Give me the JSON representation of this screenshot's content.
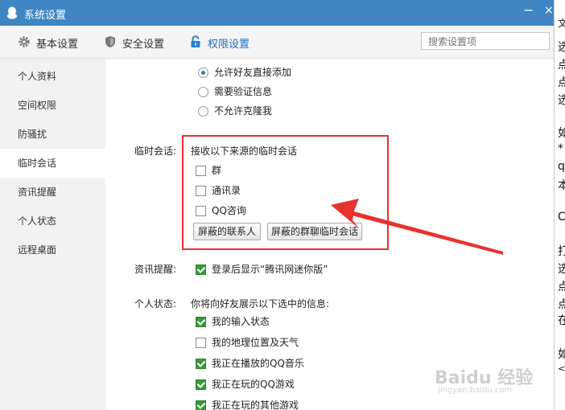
{
  "window": {
    "title": "系统设置",
    "minimize": "−",
    "close": "×"
  },
  "toolbar": {
    "tabs": [
      {
        "label": "基本设置",
        "icon": "gear-icon"
      },
      {
        "label": "安全设置",
        "icon": "shield-icon"
      },
      {
        "label": "权限设置",
        "icon": "lock-icon"
      }
    ],
    "active_tab": "权限设置",
    "search_placeholder": "搜索设置项"
  },
  "sidebar": {
    "items": [
      {
        "label": "个人资料"
      },
      {
        "label": "空间权限"
      },
      {
        "label": "防骚扰"
      },
      {
        "label": "临时会话"
      },
      {
        "label": "资讯提醒"
      },
      {
        "label": "个人状态"
      },
      {
        "label": "远程桌面"
      }
    ],
    "selected": "临时会话"
  },
  "friend_add": {
    "options": [
      {
        "label": "允许好友直接添加",
        "selected": true
      },
      {
        "label": "需要验证信息",
        "selected": false
      },
      {
        "label": "不允许克隆我",
        "selected": false
      }
    ]
  },
  "temp_session": {
    "label": "临时会话:",
    "heading": "接收以下来源的临时会话",
    "options": [
      {
        "label": "群",
        "checked": false
      },
      {
        "label": "通讯录",
        "checked": false
      },
      {
        "label": "QQ咨询",
        "checked": false
      }
    ],
    "buttons": {
      "blocked_contacts": "屏蔽的联系人",
      "blocked_group_chats": "屏蔽的群聊临时会话"
    }
  },
  "news_reminder": {
    "label": "资讯提醒:",
    "option": {
      "label": "登录后显示“腾讯网迷你版”",
      "checked": true
    }
  },
  "personal_status": {
    "label": "个人状态:",
    "heading": "你将向好友展示以下选中的信息:",
    "options": [
      {
        "label": "我的输入状态",
        "checked": true
      },
      {
        "label": "我的地理位置及天气",
        "checked": false
      },
      {
        "label": "我正在播放的QQ音乐",
        "checked": true
      },
      {
        "label": "我正在玩的QQ游戏",
        "checked": true
      },
      {
        "label": "我正在玩的其他游戏",
        "checked": true
      }
    ]
  },
  "background_window": {
    "fragments": [
      "文",
      "选",
      "点",
      "点",
      "选",
      "如",
      "*",
      "q",
      "本",
      "C",
      "打",
      "选",
      "点",
      "点",
      "在",
      "如",
      "<"
    ]
  },
  "watermark": {
    "brand": "Baidu 经验",
    "url": "jingyan.baidu.com"
  },
  "annotation": {
    "box_color": "#e8322e",
    "arrow_color": "#e8322e"
  }
}
